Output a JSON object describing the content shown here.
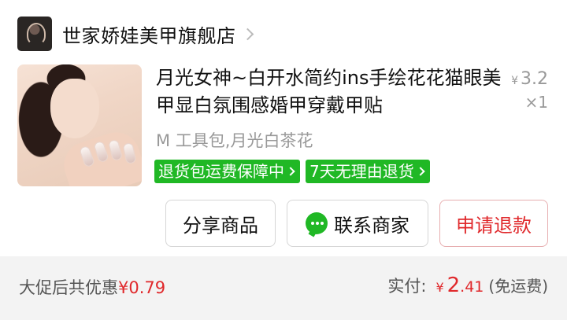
{
  "shop": {
    "name": "世家娇娃美甲旗舰店"
  },
  "product": {
    "title": "月光女神~白开水简约ins手绘花花猫眼美甲显白氛围感婚甲穿戴甲贴",
    "currency": "¥",
    "price": "3.2",
    "quantity": "×1",
    "sku": "M 工具包,月光白茶花",
    "badges": [
      {
        "label": "退货包运费保障中"
      },
      {
        "label": "7天无理由退货"
      }
    ]
  },
  "actions": {
    "share_label": "分享商品",
    "contact_label": "联系商家",
    "refund_label": "申请退款"
  },
  "summary": {
    "discount_label": "大促后共优惠",
    "discount_amount": "¥0.79",
    "paid_label": "实付:",
    "paid_currency": "¥",
    "paid_int": "2",
    "paid_dec": ".41",
    "shipping_note": "(免运费)"
  },
  "colors": {
    "accent_red": "#e0282b",
    "badge_green": "#20b825"
  }
}
